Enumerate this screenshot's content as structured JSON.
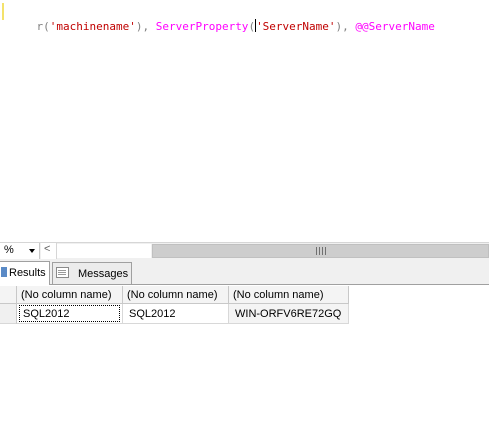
{
  "editor": {
    "tokens": [
      {
        "text": "r(",
        "kind": "gray"
      },
      {
        "text": "'machinename'",
        "kind": "str"
      },
      {
        "text": "), ",
        "kind": "gray"
      },
      {
        "text": "ServerProperty",
        "kind": "fn"
      },
      {
        "text": "(",
        "kind": "gray"
      },
      {
        "text": "'ServerName'",
        "kind": "str"
      },
      {
        "text": "), ",
        "kind": "gray"
      },
      {
        "text": "@@ServerName",
        "kind": "fn"
      }
    ]
  },
  "zoom": {
    "value": "%"
  },
  "scrollbar": {
    "left_arrow": "<"
  },
  "tabs": {
    "results": "Results",
    "messages": "Messages"
  },
  "grid": {
    "headers": [
      "(No column name)",
      "(No column name)",
      "(No column name)"
    ],
    "rows": [
      [
        "SQL2012",
        "SQL2012",
        "WIN-ORFV6RE72GQ"
      ]
    ]
  },
  "colors": {
    "string": "#c00000",
    "function": "#ff00ff",
    "punctuation": "#808080"
  }
}
